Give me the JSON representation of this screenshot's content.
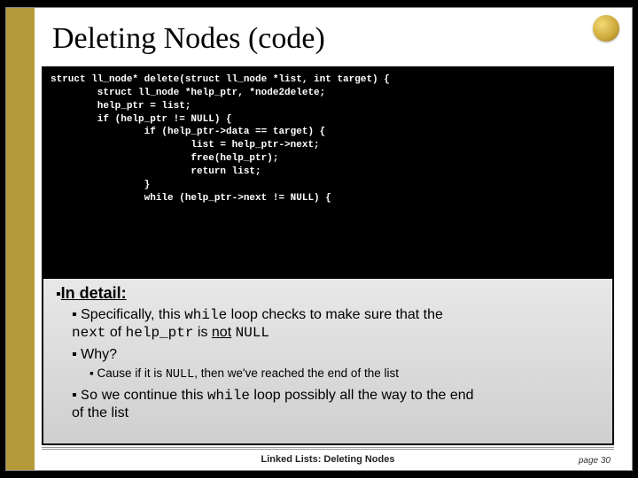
{
  "title": "Deleting Nodes (code)",
  "code": "struct ll_node* delete(struct ll_node *list, int target) {\n        struct ll_node *help_ptr, *node2delete;\n        help_ptr = list;\n        if (help_ptr != NULL) {\n                if (help_ptr->data == target) {\n                        list = help_ptr->next;\n                        free(help_ptr);\n                        return list;\n                }\n                while (help_ptr->next != NULL) {",
  "detail": {
    "heading": "In detail:",
    "line1a": "Specifically, this ",
    "while1": "while",
    "line1b": " loop checks to make sure that the",
    "line1c": "next",
    "line1d": " of ",
    "line1e": "help_ptr",
    "line1f": " is ",
    "line1g": "not",
    "line1h": " ",
    "line1i": "NULL",
    "why": "Why?",
    "cause_a": "Cause if it is ",
    "cause_null": "NULL",
    "cause_b": ", then we've reached the end of the list",
    "so_a": "So",
    "so_b": " we continue this ",
    "so_while": "while",
    "so_c": " loop possibly all the way to the end",
    "so_d": "of the list"
  },
  "footer": {
    "section": "Linked Lists:  Deleting Nodes",
    "page": "page 30"
  }
}
